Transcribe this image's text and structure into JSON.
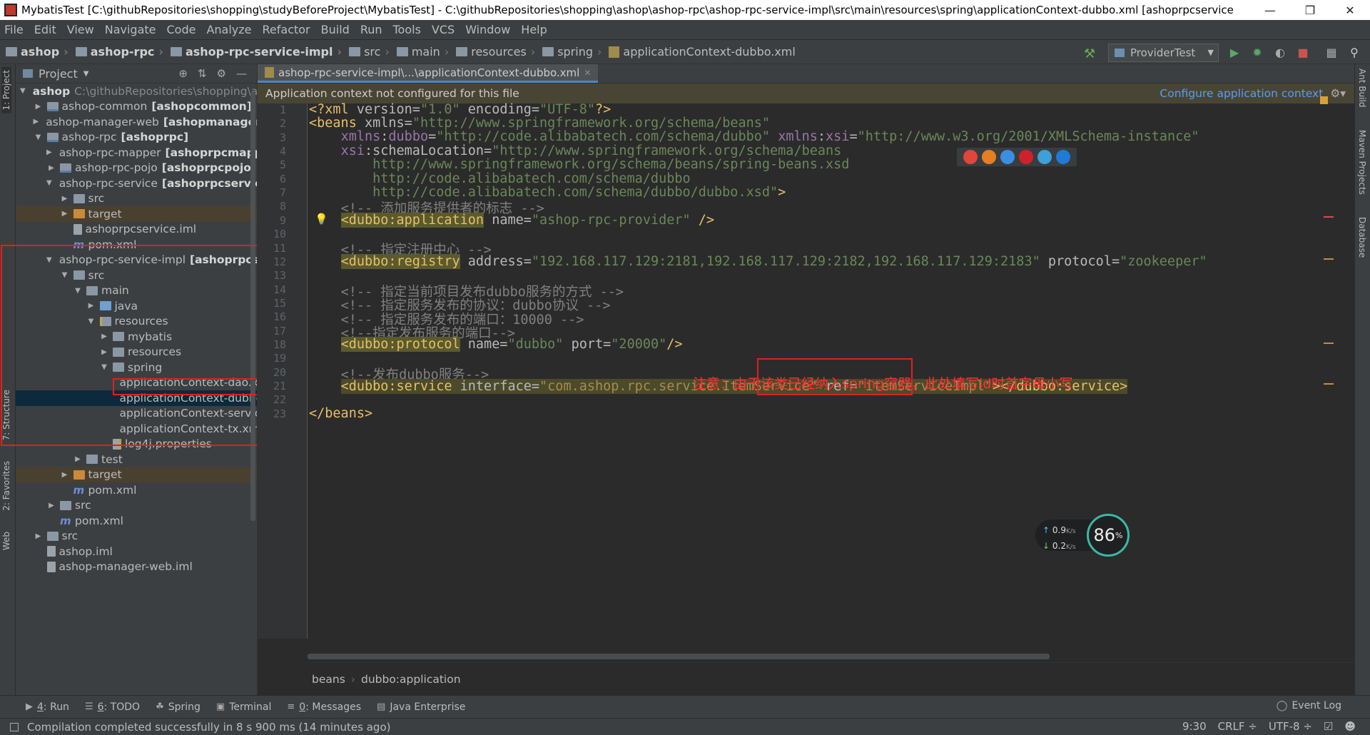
{
  "window": {
    "title": "MybatisTest [C:\\githubRepositories\\shopping\\studyBeforeProject\\MybatisTest] - C:\\githubRepositories\\shopping\\ashop\\ashop-rpc\\ashop-rpc-service-impl\\src\\main\\resources\\spring\\applicationContext-dubbo.xml [ashoprpcservicei..."
  },
  "menu": [
    "File",
    "Edit",
    "View",
    "Navigate",
    "Code",
    "Analyze",
    "Refactor",
    "Build",
    "Run",
    "Tools",
    "VCS",
    "Window",
    "Help"
  ],
  "nav": {
    "crumbs": [
      "ashop",
      "ashop-rpc",
      "ashop-rpc-service-impl",
      "src",
      "main",
      "resources",
      "spring",
      "applicationContext-dubbo.xml"
    ],
    "run_config": "ProviderTest"
  },
  "project_panel": {
    "title": "Project",
    "tree": [
      {
        "level": 0,
        "arrow": "▼",
        "icon": "module",
        "label": "ashop",
        "extra": "C:\\githubRepositories\\shopping\\ashop",
        "bold": true
      },
      {
        "level": 1,
        "arrow": "▶",
        "icon": "module",
        "label": "ashop-common",
        "extra": "[ashopcommon]"
      },
      {
        "level": 1,
        "arrow": "▶",
        "icon": "module",
        "label": "ashop-manager-web",
        "extra": "[ashopmanagerweb]"
      },
      {
        "level": 1,
        "arrow": "▼",
        "icon": "module",
        "label": "ashop-rpc",
        "extra": "[ashoprpc]"
      },
      {
        "level": 2,
        "arrow": "▶",
        "icon": "module",
        "label": "ashop-rpc-mapper",
        "extra": "[ashoprpcmapper]"
      },
      {
        "level": 2,
        "arrow": "▶",
        "icon": "module",
        "label": "ashop-rpc-pojo",
        "extra": "[ashoprpcpojo]"
      },
      {
        "level": 2,
        "arrow": "▼",
        "icon": "module",
        "label": "ashop-rpc-service",
        "extra": "[ashoprpcservice]"
      },
      {
        "level": 3,
        "arrow": "▶",
        "icon": "folder",
        "label": "src"
      },
      {
        "level": 3,
        "arrow": "▶",
        "icon": "folder-orange",
        "label": "target",
        "hl": true
      },
      {
        "level": 3,
        "arrow": "",
        "icon": "iml",
        "label": "ashoprpcservice.iml"
      },
      {
        "level": 3,
        "arrow": "",
        "icon": "mvn",
        "label": "pom.xml"
      },
      {
        "level": 2,
        "arrow": "▼",
        "icon": "module",
        "label": "ashop-rpc-service-impl",
        "extra": "[ashoprpcserviceim"
      },
      {
        "level": 3,
        "arrow": "▼",
        "icon": "folder",
        "label": "src"
      },
      {
        "level": 4,
        "arrow": "▼",
        "icon": "folder",
        "label": "main"
      },
      {
        "level": 5,
        "arrow": "▶",
        "icon": "folder-blue",
        "label": "java"
      },
      {
        "level": 5,
        "arrow": "▼",
        "icon": "folder-res",
        "label": "resources"
      },
      {
        "level": 6,
        "arrow": "▶",
        "icon": "folder",
        "label": "mybatis"
      },
      {
        "level": 6,
        "arrow": "▶",
        "icon": "folder",
        "label": "resources"
      },
      {
        "level": 6,
        "arrow": "▼",
        "icon": "folder",
        "label": "spring"
      },
      {
        "level": 7,
        "arrow": "",
        "icon": "xml",
        "label": "applicationContext-dao.xml"
      },
      {
        "level": 7,
        "arrow": "",
        "icon": "xml",
        "label": "applicationContext-dubbo.x",
        "selected": true
      },
      {
        "level": 7,
        "arrow": "",
        "icon": "xml",
        "label": "applicationContext-service.x"
      },
      {
        "level": 7,
        "arrow": "",
        "icon": "xml",
        "label": "applicationContext-tx.xml"
      },
      {
        "level": 6,
        "arrow": "",
        "icon": "props",
        "label": "log4j.properties"
      },
      {
        "level": 4,
        "arrow": "▶",
        "icon": "folder",
        "label": "test"
      },
      {
        "level": 3,
        "arrow": "▶",
        "icon": "folder-orange",
        "label": "target",
        "hl": true
      },
      {
        "level": 3,
        "arrow": "",
        "icon": "mvn",
        "label": "pom.xml"
      },
      {
        "level": 2,
        "arrow": "▶",
        "icon": "folder",
        "label": "src"
      },
      {
        "level": 2,
        "arrow": "",
        "icon": "mvn",
        "label": "pom.xml"
      },
      {
        "level": 1,
        "arrow": "▶",
        "icon": "folder",
        "label": "src"
      },
      {
        "level": 1,
        "arrow": "",
        "icon": "iml",
        "label": "ashop.iml"
      },
      {
        "level": 1,
        "arrow": "",
        "icon": "iml",
        "label": "ashop-manager-web.iml"
      }
    ]
  },
  "editor": {
    "tab_label": "ashop-rpc-service-impl\\...\\applicationContext-dubbo.xml",
    "notice": "Application context not configured for this file",
    "notice_action": "Configure application context",
    "annotation": "注意：由于该类已经纳入spring容器，此处填写id时首字母小写",
    "line_numbers": [
      "1",
      "2",
      "3",
      "4",
      "5",
      "6",
      "7",
      "8",
      "9",
      "10",
      "11",
      "12",
      "13",
      "14",
      "15",
      "16",
      "17",
      "18",
      "19",
      "20",
      "21",
      "22",
      "23"
    ],
    "breadcrumb": [
      "beans",
      "dubbo:application"
    ]
  },
  "network_widget": {
    "up": "0.9",
    "down": "0.2",
    "unit": "K/s",
    "percent": "86",
    "percent_unit": "%"
  },
  "bottom_tools": [
    {
      "key": "4",
      "label": ": Run",
      "icon": "run-icon"
    },
    {
      "key": "6",
      "label": ": TODO",
      "icon": "todo-icon"
    },
    {
      "key": "",
      "label": "Spring",
      "icon": "spring-icon"
    },
    {
      "key": "",
      "label": "Terminal",
      "icon": "terminal-icon"
    },
    {
      "key": "0",
      "label": ": Messages",
      "icon": "messages-icon"
    },
    {
      "key": "",
      "label": "Java Enterprise",
      "icon": "java-enterprise-icon"
    }
  ],
  "event_log": "Event Log",
  "status": {
    "message": "Compilation completed successfully in 8 s 900 ms (14 minutes ago)",
    "position": "9:30",
    "line_sep": "CRLF ÷",
    "encoding": "UTF-8 ÷"
  },
  "side_tabs": {
    "left": [
      "1: Project",
      "7: Structure",
      "2: Favorites",
      "Web"
    ],
    "right": [
      "Ant Build",
      "Maven Projects",
      "Database"
    ]
  }
}
